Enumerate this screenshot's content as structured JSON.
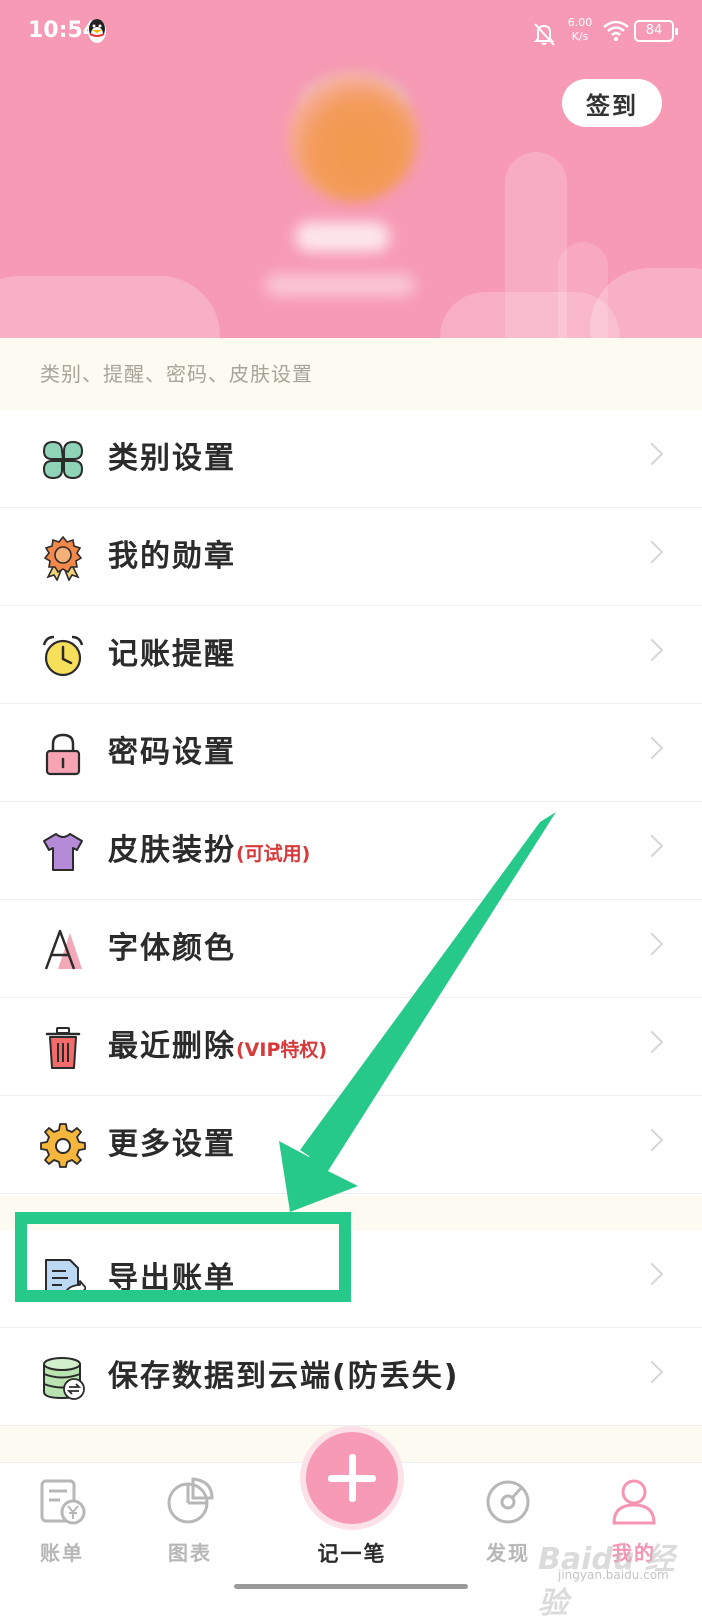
{
  "status_bar": {
    "time": "10:54",
    "network_speed": "6.00",
    "network_speed_unit": "K/s",
    "battery": "84"
  },
  "header": {
    "checkin_label": "签到",
    "background_color": "#f79ab5"
  },
  "section": {
    "title": "类别、提醒、密码、皮肤设置"
  },
  "menu": {
    "items": [
      {
        "label": "类别设置",
        "icon": "clover-icon"
      },
      {
        "label": "我的勋章",
        "icon": "medal-icon"
      },
      {
        "label": "记账提醒",
        "icon": "alarm-clock-icon"
      },
      {
        "label": "密码设置",
        "icon": "lock-icon"
      },
      {
        "label": "皮肤装扮",
        "tag": "(可试用)",
        "icon": "tshirt-icon"
      },
      {
        "label": "字体颜色",
        "icon": "font-icon"
      },
      {
        "label": "最近删除",
        "tag": "(VIP特权)",
        "icon": "trash-icon"
      },
      {
        "label": "更多设置",
        "icon": "gear-icon"
      },
      {
        "label": "导出账单",
        "icon": "export-document-icon"
      },
      {
        "label": "保存数据到云端(防丢失)",
        "icon": "database-sync-icon"
      }
    ]
  },
  "tab_bar": {
    "tabs": [
      {
        "label": "账单",
        "icon": "bill-icon"
      },
      {
        "label": "图表",
        "icon": "pie-chart-icon"
      },
      {
        "label": "记一笔",
        "icon": "plus-icon"
      },
      {
        "label": "发现",
        "icon": "compass-icon"
      },
      {
        "label": "我的",
        "icon": "person-icon"
      }
    ]
  },
  "colors": {
    "accent_pink": "#f79ab5",
    "annotation_green": "#27c98a",
    "tag_red": "#d63a3a"
  },
  "watermark": {
    "text": "Baidu 经验",
    "subtext": "jingyan.baidu.com"
  }
}
